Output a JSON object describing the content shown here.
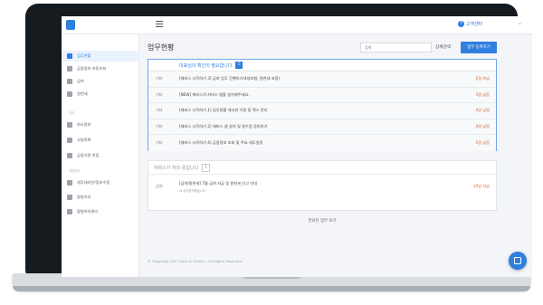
{
  "header": {
    "help_label": "고객센터",
    "help_icon": "question-icon",
    "menu_icon": "hamburger-icon"
  },
  "sidebar": {
    "items": [
      {
        "label": "업무현황",
        "icon": "clipboard-icon",
        "active": true
      },
      {
        "label": "금융정보 자동조회",
        "icon": "chart-icon",
        "active": false
      },
      {
        "label": "급여",
        "icon": "wallet-icon",
        "active": false
      },
      {
        "label": "원천세",
        "icon": "coin-icon",
        "active": false
      }
    ],
    "section1_label": "관리",
    "items2": [
      {
        "label": "회사정보",
        "icon": "building-icon"
      },
      {
        "label": "사원목록",
        "icon": "users-icon"
      },
      {
        "label": "금융기관 연동",
        "icon": "bank-icon"
      }
    ],
    "section2_label": "계정관리",
    "items3": [
      {
        "label": "세무대리인/정보수정",
        "icon": "user-icon"
      },
      {
        "label": "팝빌이라",
        "icon": "user2-icon"
      },
      {
        "label": "팝빌아리관리",
        "icon": "settings-icon"
      }
    ]
  },
  "main": {
    "title": "업무현황",
    "search_placeholder": "검색",
    "detail_link": "상세검색",
    "register_button": "업무 등록하기"
  },
  "pending_card": {
    "header": "대표님의 확인이 필요합니다",
    "count": "5",
    "rows": [
      {
        "tag": "기타",
        "text": "[재비스 시작하기 3] 급여 업무 진행하기(4대보험, 원천세 포함)",
        "time": "2일 지남"
      },
      {
        "tag": "기타",
        "text": "[NEW] 재비스의 자비스 앱을 설치해주세요.",
        "time": "3일 남음"
      },
      {
        "tag": "기타",
        "text": "[재비스 시작하기 1] 업무현황 게시판 이용 및 텍스 관리",
        "time": "4일 남음"
      },
      {
        "tag": "기타",
        "text": "[재비스 시작하기 2] 재비스 앱 설치 및 영수증 증빙하기",
        "time": "4일 남음"
      },
      {
        "tag": "기타",
        "text": "[재비스 시작하기 4] 금융정보 조회 및 주요 세무일정",
        "time": "5일 남음"
      }
    ]
  },
  "processing_card": {
    "header": "자비스가 처리 중입니다",
    "count": "1",
    "rows": [
      {
        "tag": "급여",
        "title": "[급여/원천세] 7월 급여 지급 및 원천세 신고 안내",
        "sub": "세 급여정액했습니다",
        "time": "10일 지남"
      }
    ]
  },
  "done_link": "완료된 업무 보기",
  "footer": "© Copyright 2017 Jobis & Villains - All Rights Reserved.",
  "colors": {
    "accent": "#2f7fe0",
    "overdue": "#e0592a"
  }
}
